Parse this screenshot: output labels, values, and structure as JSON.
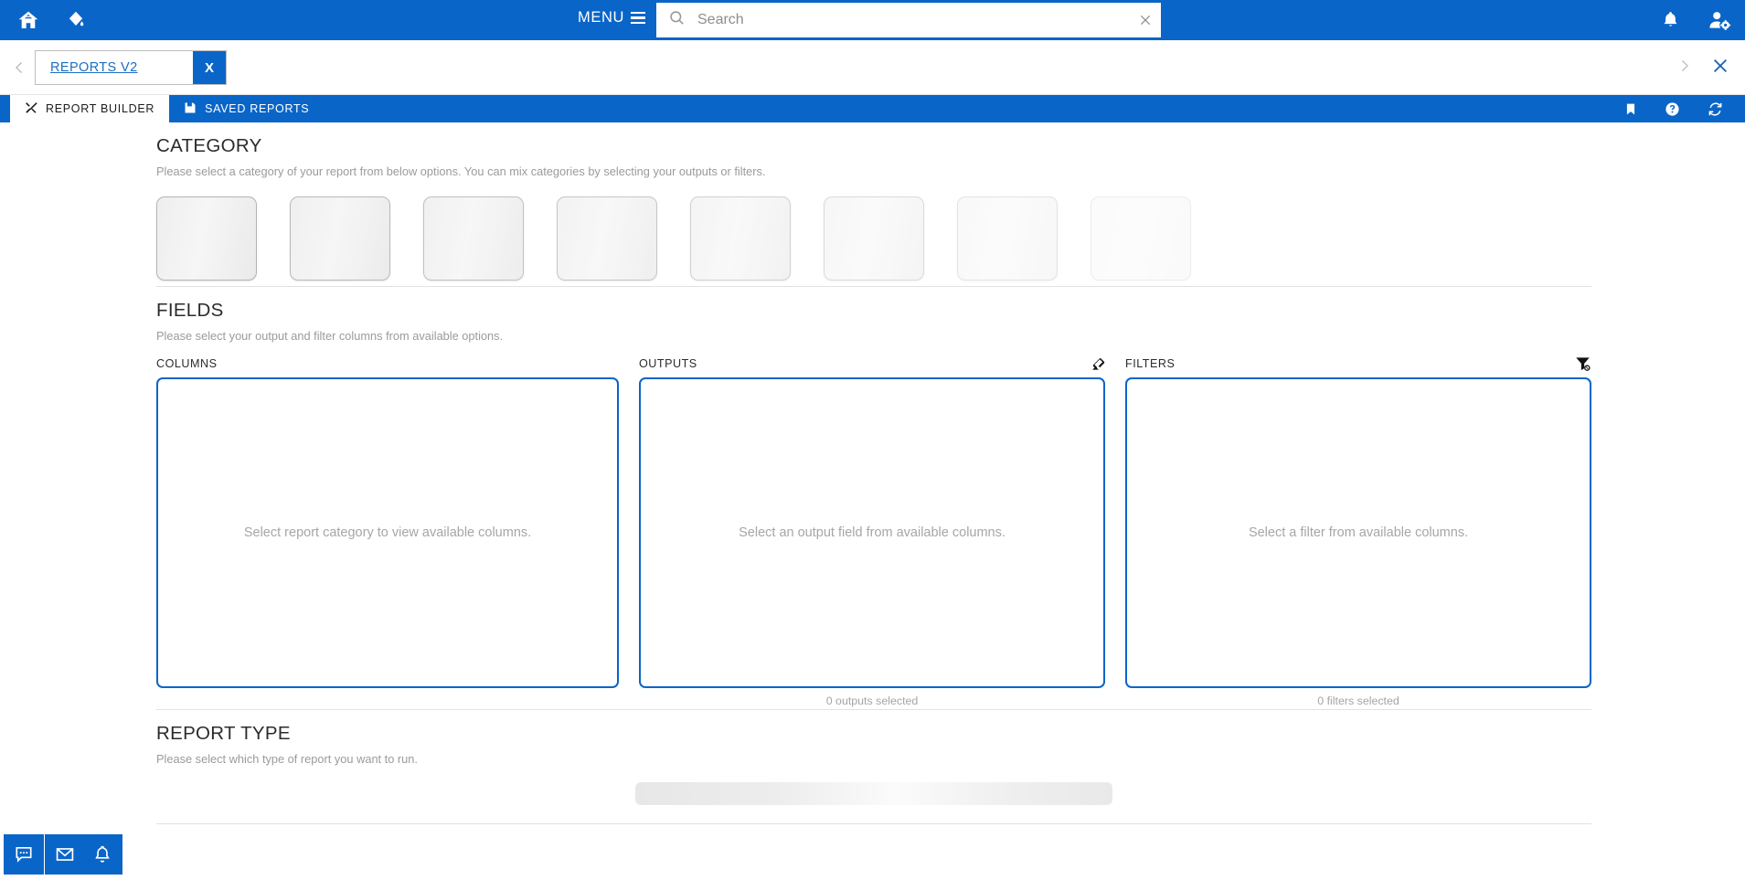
{
  "topbar": {
    "home_icon": "home-icon",
    "drop_icon": "water-drop-icon",
    "menu_label": "MENU",
    "menu_icon": "hamburger-icon",
    "search": {
      "value": "",
      "placeholder": "Search",
      "icon": "search-icon",
      "clear_icon": "clear-icon"
    },
    "notifications_icon": "bell-icon",
    "user_settings_icon": "user-settings-icon",
    "bg_color": "#0a65c8"
  },
  "tabbar": {
    "prev_icon": "chevron-left-icon",
    "next_icon": "chevron-right-icon",
    "close_all_icon": "close-icon",
    "tabs": [
      {
        "label": "REPORTS V2",
        "close_label": "X",
        "active": true
      }
    ]
  },
  "modulebar": {
    "tabs": [
      {
        "label": "REPORT BUILDER",
        "icon": "tools-icon",
        "active": true
      },
      {
        "label": "SAVED REPORTS",
        "icon": "save-icon",
        "active": false
      }
    ],
    "actions": [
      {
        "icon": "bookmark-icon"
      },
      {
        "icon": "help-icon"
      },
      {
        "icon": "refresh-icon"
      }
    ]
  },
  "category": {
    "title": "CATEGORY",
    "description": "Please select a category of your report from below options. You can mix categories by selecting your outputs or filters.",
    "tiles": [
      {
        "opacity": 1.0
      },
      {
        "opacity": 0.92
      },
      {
        "opacity": 0.84
      },
      {
        "opacity": 0.74
      },
      {
        "opacity": 0.62
      },
      {
        "opacity": 0.48
      },
      {
        "opacity": 0.36
      },
      {
        "opacity": 0.24
      }
    ]
  },
  "fields": {
    "title": "FIELDS",
    "description": "Please select your output and filter columns from available options.",
    "columns_panel": {
      "title": "COLUMNS",
      "hint": "Select report category to view available columns.",
      "footer": ""
    },
    "outputs_panel": {
      "title": "OUTPUTS",
      "hint": "Select an output field from available columns.",
      "footer": "0 outputs selected",
      "action_icon": "eraser-icon"
    },
    "filters_panel": {
      "title": "FILTERS",
      "hint": "Select a filter from available columns.",
      "footer": "0 filters selected",
      "action_icon": "filter-clear-icon"
    }
  },
  "report_type": {
    "title": "REPORT TYPE",
    "description": "Please select which type of report you want to run."
  },
  "footer": {
    "buttons": [
      {
        "icon": "chat-icon"
      },
      {
        "icon": "mail-icon"
      },
      {
        "icon": "bell-icon"
      }
    ]
  },
  "theme": {
    "accent": "#0a65c8",
    "panel_border": "#0a65c8",
    "muted_text": "#a6a6a6"
  }
}
